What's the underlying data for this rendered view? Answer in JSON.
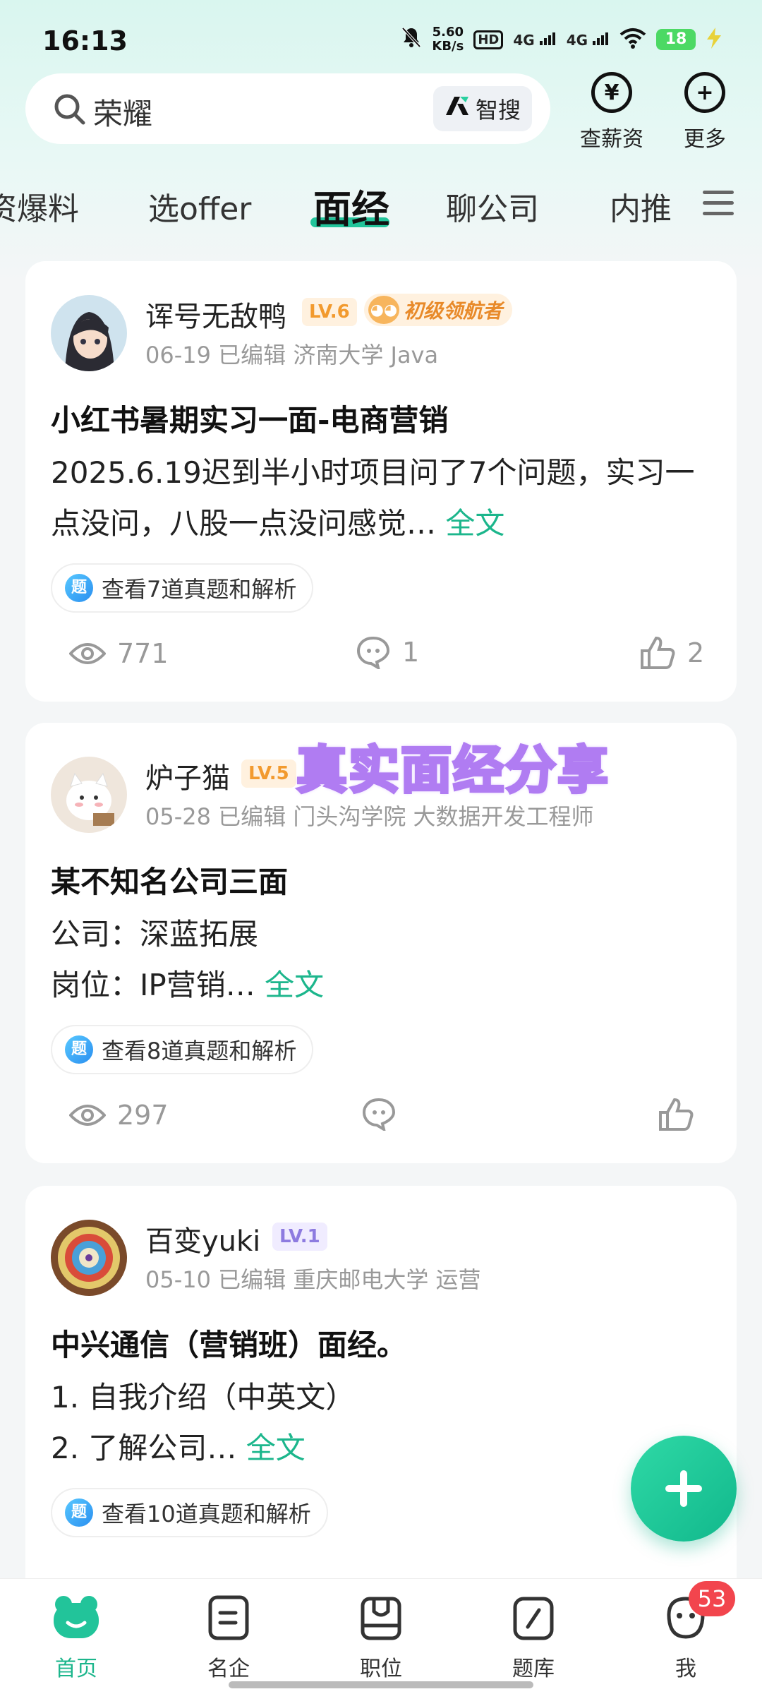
{
  "status_bar": {
    "time": "16:13",
    "net_speed_value": "5.60",
    "net_speed_unit": "KB/s",
    "hd_label": "HD",
    "network_1": "4G",
    "network_2": "4G",
    "battery": "18"
  },
  "search": {
    "query": "荣耀",
    "smart_search_label": "智搜"
  },
  "top_actions": {
    "salary_label": "查薪资",
    "more_label": "更多"
  },
  "tabs": [
    {
      "label": "资爆料"
    },
    {
      "label": "选offer"
    },
    {
      "label": "面经"
    },
    {
      "label": "聊公司"
    },
    {
      "label": "内推"
    }
  ],
  "posts": [
    {
      "username": "诨号无敌鸭",
      "level": "LV.6",
      "honor": "初级领航者",
      "meta": "06-19 已编辑  济南大学 Java",
      "title": "小红书暑期实习一面-电商营销",
      "body": "2025.6.19迟到半小时项目问了7个问题，实习一点没问，八股一点没问感觉…",
      "full_text_link": "全文",
      "questions_chip": "查看7道真题和解析",
      "chip_icon_text": "题",
      "views": "771",
      "comments": "1",
      "likes": "2"
    },
    {
      "username": "炉子猫",
      "level": "LV.5",
      "meta": "05-28 已编辑  门头沟学院 大数据开发工程师",
      "title": "某不知名公司三面",
      "body_line1": "公司：深蓝拓展",
      "body_line2": "岗位：IP营销…",
      "full_text_link": "全文",
      "questions_chip": "查看8道真题和解析",
      "chip_icon_text": "题",
      "views": "297"
    },
    {
      "username": "百变yuki",
      "level": "LV.1",
      "meta": "05-10 已编辑  重庆邮电大学 运营",
      "title": "中兴通信（营销班）面经。",
      "body_line1": "1. 自我介绍（中英文）",
      "body_line2": "2. 了解公司…",
      "full_text_link": "全文",
      "questions_chip": "查看10道真题和解析",
      "chip_icon_text": "题"
    }
  ],
  "overlay_text": "真实面经分享",
  "bottom_nav": [
    {
      "label": "首页"
    },
    {
      "label": "名企"
    },
    {
      "label": "职位"
    },
    {
      "label": "题库"
    },
    {
      "label": "我"
    }
  ],
  "notification_badge": "53",
  "colors": {
    "accent": "#1cb68c",
    "tab_underline": "#22c49a",
    "badge": "#f2454d",
    "overlay_stroke": "#b07cf2"
  }
}
